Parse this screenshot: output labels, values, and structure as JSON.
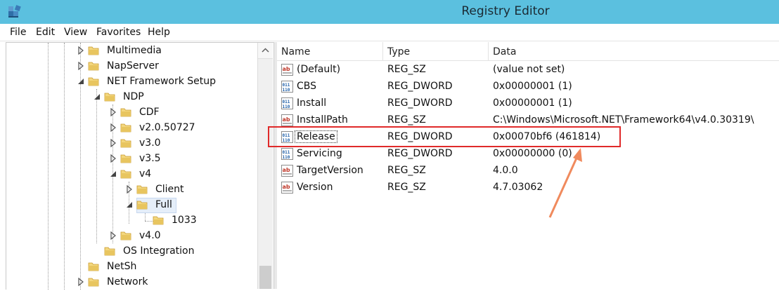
{
  "window": {
    "title": "Registry Editor"
  },
  "menu": [
    "File",
    "Edit",
    "View",
    "Favorites",
    "Help"
  ],
  "tree": [
    {
      "label": "Multimedia",
      "expander": "collapsed"
    },
    {
      "label": "NapServer",
      "expander": "collapsed"
    },
    {
      "label": "NET Framework Setup",
      "expander": "expanded"
    },
    {
      "label": "NDP",
      "expander": "expanded"
    },
    {
      "label": "CDF",
      "expander": "collapsed"
    },
    {
      "label": "v2.0.50727",
      "expander": "collapsed"
    },
    {
      "label": "v3.0",
      "expander": "collapsed"
    },
    {
      "label": "v3.5",
      "expander": "collapsed"
    },
    {
      "label": "v4",
      "expander": "expanded"
    },
    {
      "label": "Client",
      "expander": "collapsed"
    },
    {
      "label": "Full",
      "expander": "expanded",
      "selected": true
    },
    {
      "label": "1033",
      "expander": "none"
    },
    {
      "label": "v4.0",
      "expander": "collapsed"
    },
    {
      "label": "OS Integration",
      "expander": "none"
    },
    {
      "label": "NetSh",
      "expander": "none"
    },
    {
      "label": "Network",
      "expander": "collapsed"
    }
  ],
  "list": {
    "columns": [
      "Name",
      "Type",
      "Data"
    ],
    "rows": [
      {
        "name": "(Default)",
        "type": "REG_SZ",
        "data": "(value not set)",
        "icon": "string-value-icon"
      },
      {
        "name": "CBS",
        "type": "REG_DWORD",
        "data": "0x00000001 (1)",
        "icon": "binary-value-icon"
      },
      {
        "name": "Install",
        "type": "REG_DWORD",
        "data": "0x00000001 (1)",
        "icon": "binary-value-icon"
      },
      {
        "name": "InstallPath",
        "type": "REG_SZ",
        "data": "C:\\Windows\\Microsoft.NET\\Framework64\\v4.0.30319\\",
        "icon": "string-value-icon"
      },
      {
        "name": "Release",
        "type": "REG_DWORD",
        "data": "0x00070bf6 (461814)",
        "icon": "binary-value-icon",
        "highlighted": true
      },
      {
        "name": "Servicing",
        "type": "REG_DWORD",
        "data": "0x00000000 (0)",
        "icon": "binary-value-icon"
      },
      {
        "name": "TargetVersion",
        "type": "REG_SZ",
        "data": "4.0.0",
        "icon": "string-value-icon"
      },
      {
        "name": "Version",
        "type": "REG_SZ",
        "data": "4.7.03062",
        "icon": "string-value-icon"
      }
    ]
  },
  "colors": {
    "titlebar": "#5bc0df",
    "highlight_box": "#e02a2a",
    "arrow": "#f08a5d",
    "folder": "#e8c55f"
  }
}
